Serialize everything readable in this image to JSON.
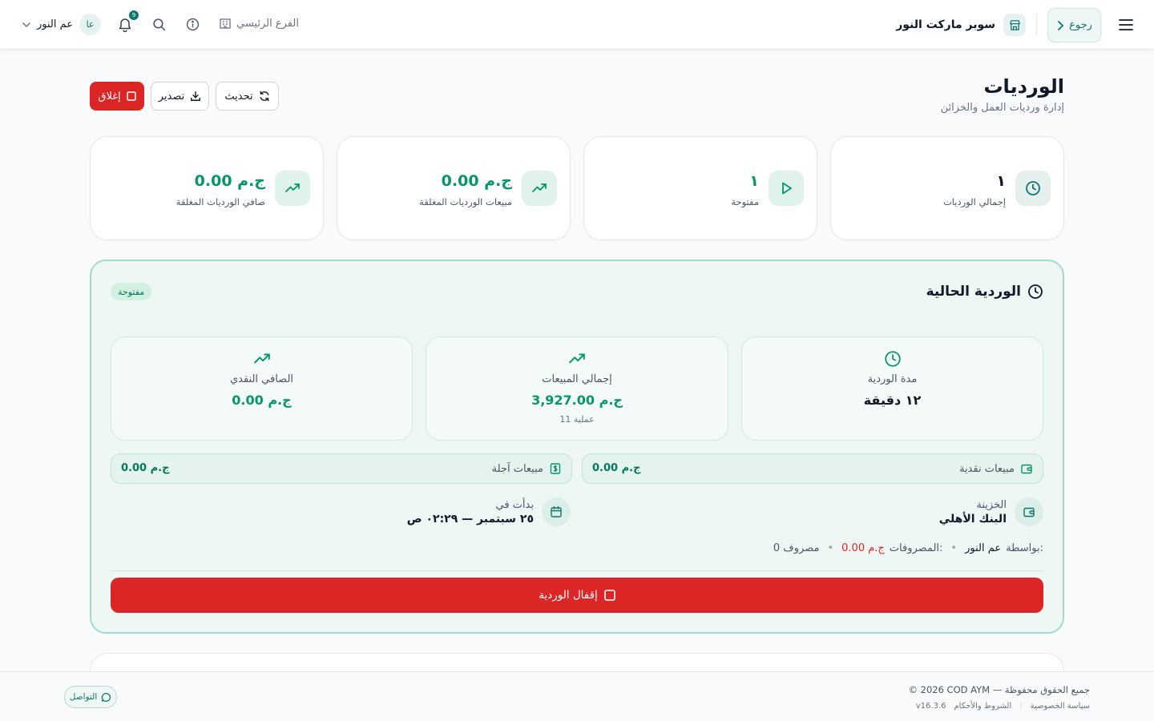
{
  "topbar": {
    "back_label": "رجوع",
    "store_name": "سوبر ماركت النور",
    "branch_label": "الفرع الرئيسي",
    "notification_count": "9",
    "user_name": "عم النور",
    "user_initials": "عا"
  },
  "header": {
    "title": "الورديات",
    "subtitle": "إدارة ورديات العمل والخزائن",
    "refresh_label": "تحديث",
    "export_label": "تصدير",
    "close_label": "إغلاق"
  },
  "stats": [
    {
      "value": "١",
      "label": "إجمالي الورديات",
      "icon": "clock-icon"
    },
    {
      "value": "١",
      "label": "مفتوحة",
      "icon": "play-icon"
    },
    {
      "value": "0.00 ج.م",
      "label": "مبيعات الورديات المغلقة",
      "icon": "trending-up-icon"
    },
    {
      "value": "0.00 ج.م",
      "label": "صافي الورديات المغلقة",
      "icon": "trending-up-icon"
    }
  ],
  "current_shift": {
    "title": "الوردية الحالية",
    "status": "مفتوحة",
    "duration": {
      "label": "مدة الوردية",
      "value": "١٢ دقيقة"
    },
    "total_sales": {
      "label": "إجمالي المبيعات",
      "value": "3,927.00 ج.م",
      "sub": "11 عملية"
    },
    "net_cash": {
      "label": "الصافي النقدي",
      "value": "0.00 ج.م"
    },
    "cash_sales": {
      "label": "مبيعات نقدية",
      "value": "0.00 ج.م"
    },
    "credit_sales": {
      "label": "مبيعات آجلة",
      "value": "0.00 ج.م"
    },
    "treasury": {
      "label": "الخزينة",
      "value": "البنك الأهلي"
    },
    "started_at": {
      "label": "بدأت في",
      "value": "٢٥ سبتمبر — ٠٢:٢٩ ص"
    },
    "by_label": "بواسطة:",
    "by_value": "عم النور",
    "expenses_label": "المصروفات:",
    "expenses_value": "0.00 ج.م",
    "expenses_count": "0 مصروف",
    "lock_label": "إقفال الوردية"
  },
  "footer": {
    "copyright": "© 2026 COD AYM — جميع الحقوق محفوظة",
    "privacy": "سياسة الخصوصية",
    "terms": "الشروط والأحكام",
    "version": "v16.3.6",
    "contact": "التواصل"
  },
  "colors": {
    "brand": "#0f766e",
    "positive": "#059669",
    "danger": "#dc2626",
    "shift_bg": "#eef7f4"
  }
}
